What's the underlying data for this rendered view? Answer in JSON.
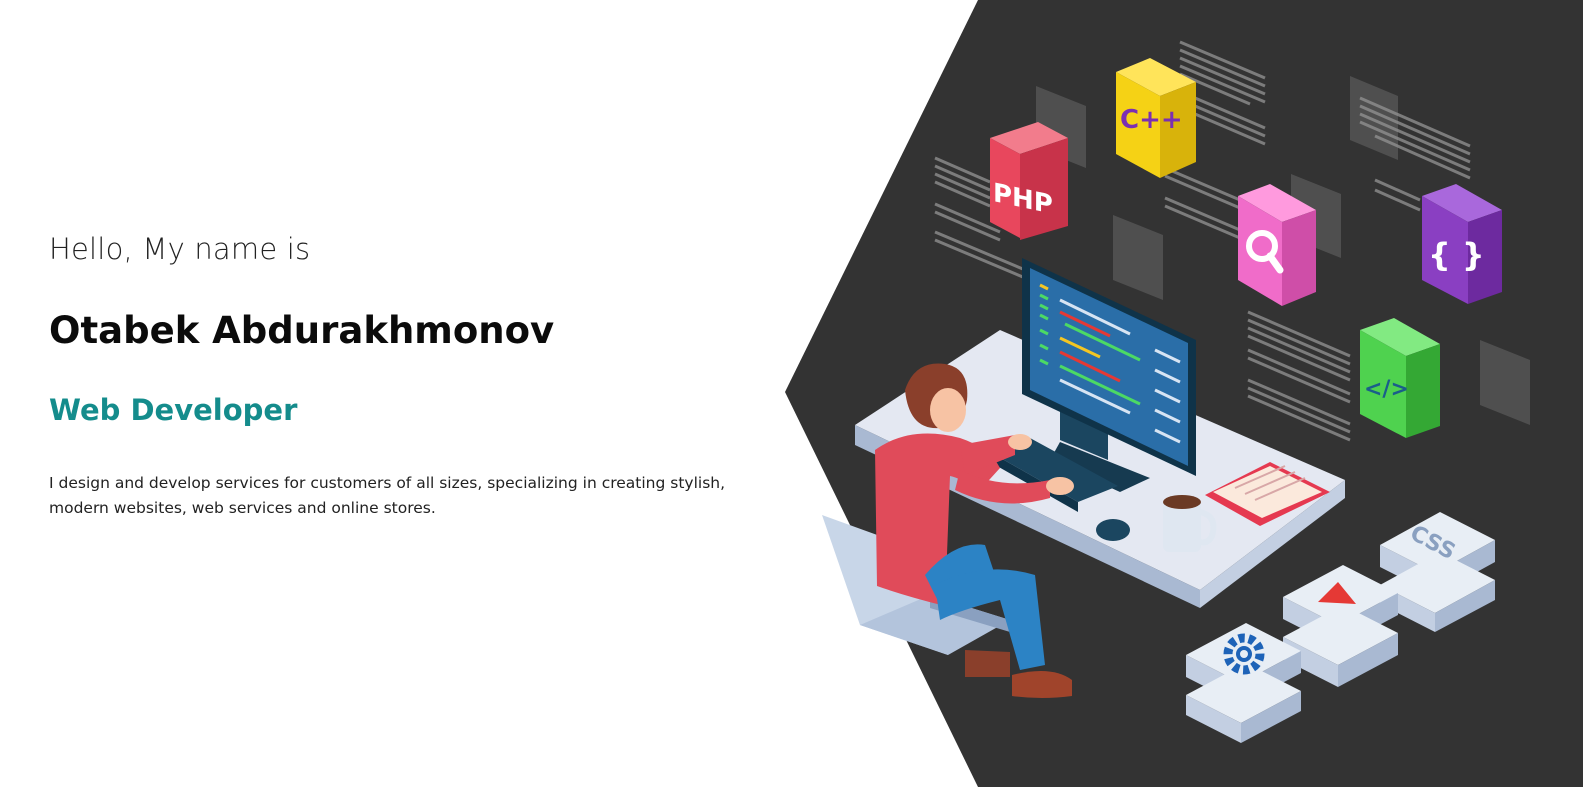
{
  "hero": {
    "greeting": "Hello, My name is",
    "name": "Otabek Abdurakhmonov",
    "role": "Web Developer",
    "description": "I design and develop services for customers of all sizes, specializing in creating stylish, modern websites, web services and online stores."
  },
  "illustration": {
    "tiles": [
      {
        "label": "PHP",
        "icon": "php-tile-icon",
        "color": "#e8475d"
      },
      {
        "label": "C++",
        "icon": "cpp-tile-icon",
        "color": "#f5d215"
      },
      {
        "label": "",
        "icon": "search-tile-icon",
        "color": "#f06cc9"
      },
      {
        "label": "{ }",
        "icon": "braces-tile-icon",
        "color": "#8a3fc2"
      },
      {
        "label": "</>",
        "icon": "code-tile-icon",
        "color": "#4fd24f"
      },
      {
        "label": "CSS",
        "icon": "css-block-icon",
        "color": "#e8eef5"
      },
      {
        "label": "",
        "icon": "play-block-icon",
        "color": "#e53935"
      },
      {
        "label": "",
        "icon": "gear-block-icon",
        "color": "#1e63b8"
      }
    ],
    "colors": {
      "background": "#333333",
      "accent": "#148c8c"
    }
  }
}
